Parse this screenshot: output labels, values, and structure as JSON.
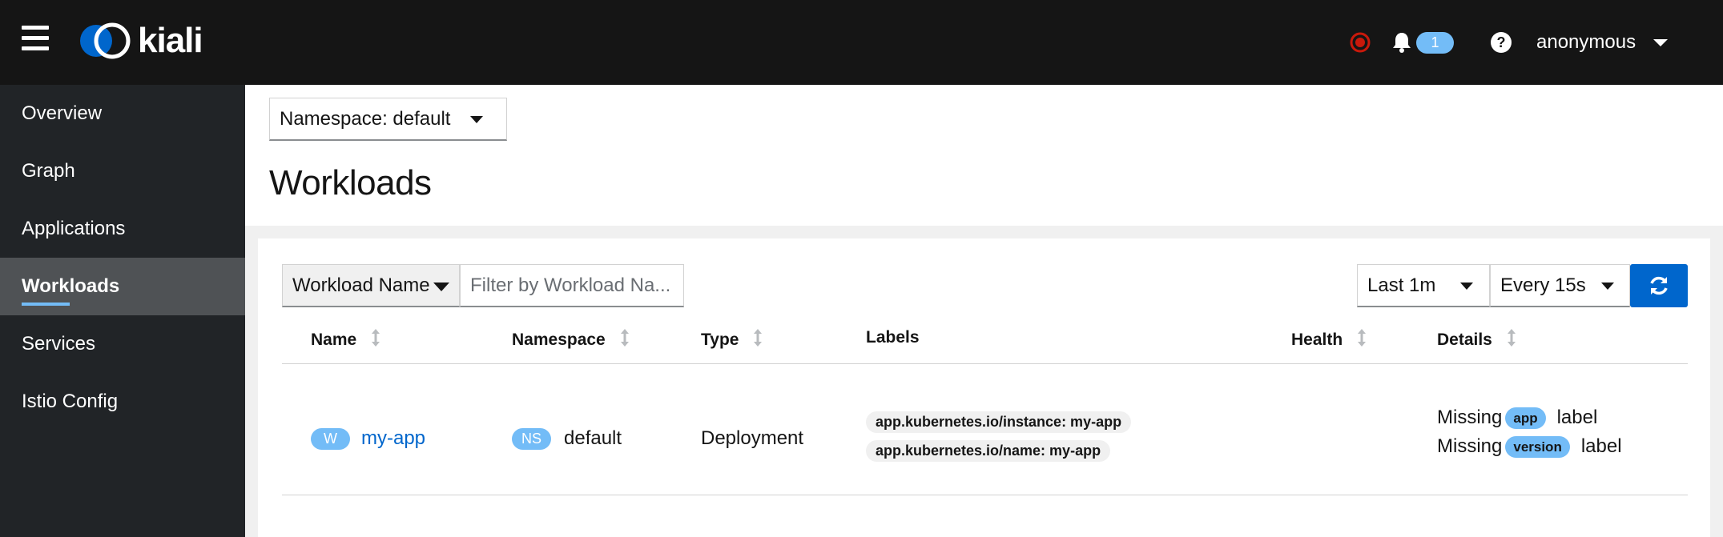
{
  "masthead": {
    "brand": "kiali",
    "notification_count": "1",
    "user": "anonymous",
    "colors": {
      "background": "#151515",
      "status_error": "#c9190b",
      "badge": "#73bcf7"
    }
  },
  "sidebar": {
    "items": [
      {
        "label": "Overview"
      },
      {
        "label": "Graph"
      },
      {
        "label": "Applications"
      },
      {
        "label": "Workloads",
        "active": true
      },
      {
        "label": "Services"
      },
      {
        "label": "Istio Config"
      }
    ]
  },
  "toolbar": {
    "namespace_select": "Namespace: default"
  },
  "page": {
    "title": "Workloads"
  },
  "filters": {
    "type_select": "Workload Name",
    "placeholder": "Filter by Workload Na...",
    "duration": "Last 1m",
    "refresh_interval": "Every 15s"
  },
  "table": {
    "columns": [
      "Name",
      "Namespace",
      "Type",
      "Labels",
      "Health",
      "Details"
    ],
    "rows": [
      {
        "name_badge": "W",
        "name": "my-app",
        "namespace_badge": "NS",
        "namespace": "default",
        "type": "Deployment",
        "labels": [
          "app.kubernetes.io/instance: my-app",
          "app.kubernetes.io/name: my-app"
        ],
        "details": [
          {
            "prefix": "Missing",
            "label": "app",
            "suffix": "label"
          },
          {
            "prefix": "Missing",
            "label": "version",
            "suffix": "label"
          }
        ]
      }
    ]
  },
  "icons": [
    "menu-icon",
    "kiali-logo-icon",
    "status-error-icon",
    "bell-icon",
    "help-icon",
    "caret-down-icon",
    "sort-icon",
    "refresh-icon"
  ]
}
